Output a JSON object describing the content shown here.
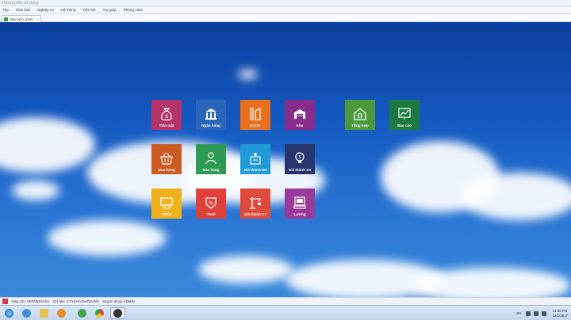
{
  "window": {
    "title": "Hướng dẫn sử dụng"
  },
  "menu": [
    {
      "label": "Tệp"
    },
    {
      "label": "Khai báo"
    },
    {
      "label": "Nghiệp vụ"
    },
    {
      "label": "Hệ thống"
    },
    {
      "label": "Tiện ích"
    },
    {
      "label": "Trợ giúp"
    },
    {
      "label": "Phong cách"
    }
  ],
  "tab": {
    "label": "Hàn bình chính",
    "close": "×"
  },
  "tiles": [
    {
      "label": "Tiền mặt",
      "color": "#b3336a",
      "icon": "money-bag-icon"
    },
    {
      "label": "Ngân hàng",
      "color": "#2b66b8",
      "icon": "bank-icon"
    },
    {
      "label": "CCDC",
      "color": "#e8711f",
      "icon": "tools-icon"
    },
    {
      "label": "Kho",
      "color": "#8a2c8c",
      "icon": "warehouse-icon"
    },
    {
      "label": "Tổng hợp",
      "color": "#4a9a3c",
      "icon": "house-summary-icon"
    },
    {
      "label": "Báo cáo",
      "color": "#1d7a3f",
      "icon": "report-chart-icon"
    },
    {
      "label": "Mua hàng",
      "color": "#cc5a23",
      "icon": "basket-icon"
    },
    {
      "label": "Bán hàng",
      "color": "#2f9a54",
      "icon": "salesperson-icon"
    },
    {
      "label": "Giá thành ĐH",
      "color": "#1f9ad6",
      "icon": "order-cost-icon"
    },
    {
      "label": "Giá thành SX",
      "color": "#27356e",
      "icon": "lightbulb-icon"
    },
    {
      "label": "TSCĐ",
      "color": "#f0b21c",
      "icon": "fixed-asset-icon"
    },
    {
      "label": "Thuế",
      "color": "#e0403a",
      "icon": "tax-icon"
    },
    {
      "label": "Giá thành CT",
      "color": "#e04a3a",
      "icon": "crane-icon"
    },
    {
      "label": "Lương",
      "color": "#9a3a9a",
      "icon": "payroll-icon"
    }
  ],
  "status": {
    "server": "Máy chủ: SERVER\\ASU",
    "database": "Dữ liệu: CTYXAYANATDUNG",
    "user": "Người dùng: ADMIN"
  },
  "taskbar": {
    "apps": [
      {
        "icon": "windows-start-icon",
        "color": "#3aa0e0"
      },
      {
        "icon": "internet-explorer-icon",
        "color": "#3f8fd8"
      },
      {
        "icon": "file-explorer-icon",
        "color": "#e7c04a"
      },
      {
        "icon": "media-player-icon",
        "color": "#e88a2a"
      },
      {
        "icon": "app-green-icon",
        "color": "#4aa04a"
      },
      {
        "icon": "chrome-icon",
        "color": "#d84a3a"
      },
      {
        "icon": "app-dark-icon",
        "color": "#333333"
      }
    ],
    "lang": "EN",
    "time": "11:08 PM",
    "date": "12/2/2017"
  }
}
